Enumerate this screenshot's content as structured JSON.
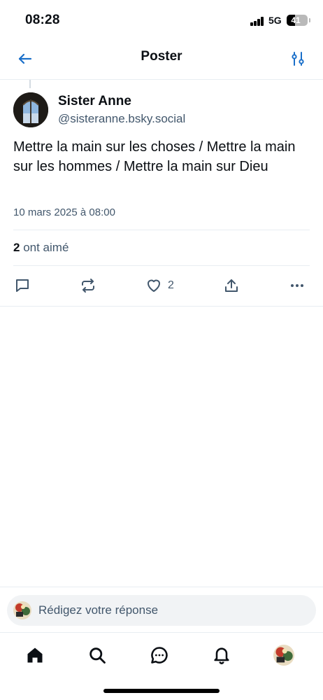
{
  "status_bar": {
    "time": "08:28",
    "network": "5G",
    "battery": "41",
    "battery_level": 0.41
  },
  "header": {
    "title": "Poster",
    "back_icon": "arrow-left-icon",
    "settings_icon": "sliders-icon"
  },
  "post": {
    "author_name": "Sister Anne",
    "author_handle": "@sisteranne.bsky.social",
    "text": "Mettre la main sur les choses / Mettre la main sur les hommes / Mettre la main sur Dieu",
    "date": "10 mars 2025 à 08:00",
    "likes_count": "2",
    "likes_label": "ont aimé",
    "actions": {
      "reply_icon": "comment-icon",
      "repost_icon": "repost-icon",
      "like_icon": "heart-icon",
      "like_count": "2",
      "share_icon": "share-icon",
      "more_icon": "more-icon"
    }
  },
  "reply_bar": {
    "placeholder": "Rédigez votre réponse"
  },
  "tab_bar": {
    "items": [
      "home-icon",
      "search-icon",
      "chat-icon",
      "bell-icon",
      "profile-avatar"
    ]
  },
  "colors": {
    "text": "#0b0f14",
    "muted": "#42576c",
    "accent": "#1083fe",
    "divider": "#e8edf2"
  }
}
